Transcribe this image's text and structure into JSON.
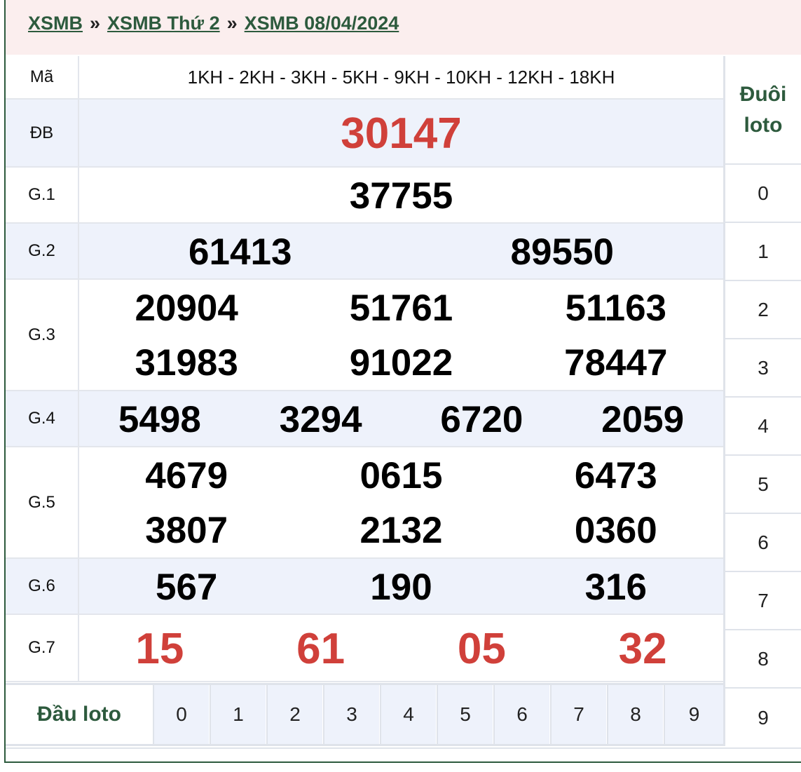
{
  "breadcrumb": {
    "items": [
      "XSMB",
      "XSMB Thứ 2",
      "XSMB 08/04/2024"
    ],
    "separator": "»"
  },
  "table": {
    "code_label": "Mã",
    "codes": "1KH - 2KH - 3KH - 5KH - 9KH - 10KH - 12KH - 18KH",
    "special": {
      "label": "ĐB",
      "number": "30147"
    },
    "g1": {
      "label": "G.1",
      "numbers": [
        "37755"
      ]
    },
    "g2": {
      "label": "G.2",
      "numbers": [
        "61413",
        "89550"
      ]
    },
    "g3": {
      "label": "G.3",
      "numbers": [
        "20904",
        "51761",
        "51163",
        "31983",
        "91022",
        "78447"
      ]
    },
    "g4": {
      "label": "G.4",
      "numbers": [
        "5498",
        "3294",
        "6720",
        "2059"
      ]
    },
    "g5": {
      "label": "G.5",
      "numbers": [
        "4679",
        "0615",
        "6473",
        "3807",
        "2132",
        "0360"
      ]
    },
    "g6": {
      "label": "G.6",
      "numbers": [
        "567",
        "190",
        "316"
      ]
    },
    "g7": {
      "label": "G.7",
      "numbers": [
        "15",
        "61",
        "05",
        "32"
      ]
    }
  },
  "dau_loto": {
    "title": "Đầu loto",
    "digits": [
      "0",
      "1",
      "2",
      "3",
      "4",
      "5",
      "6",
      "7",
      "8",
      "9"
    ]
  },
  "duoi_loto": {
    "title_line1": "Đuôi",
    "title_line2": "loto",
    "digits": [
      "0",
      "1",
      "2",
      "3",
      "4",
      "5",
      "6",
      "7",
      "8",
      "9"
    ]
  },
  "colors": {
    "accent_green": "#2d5a3d",
    "highlight_red": "#d0403a",
    "row_alt": "#eef2fb",
    "header_bg": "#fbeeee"
  }
}
